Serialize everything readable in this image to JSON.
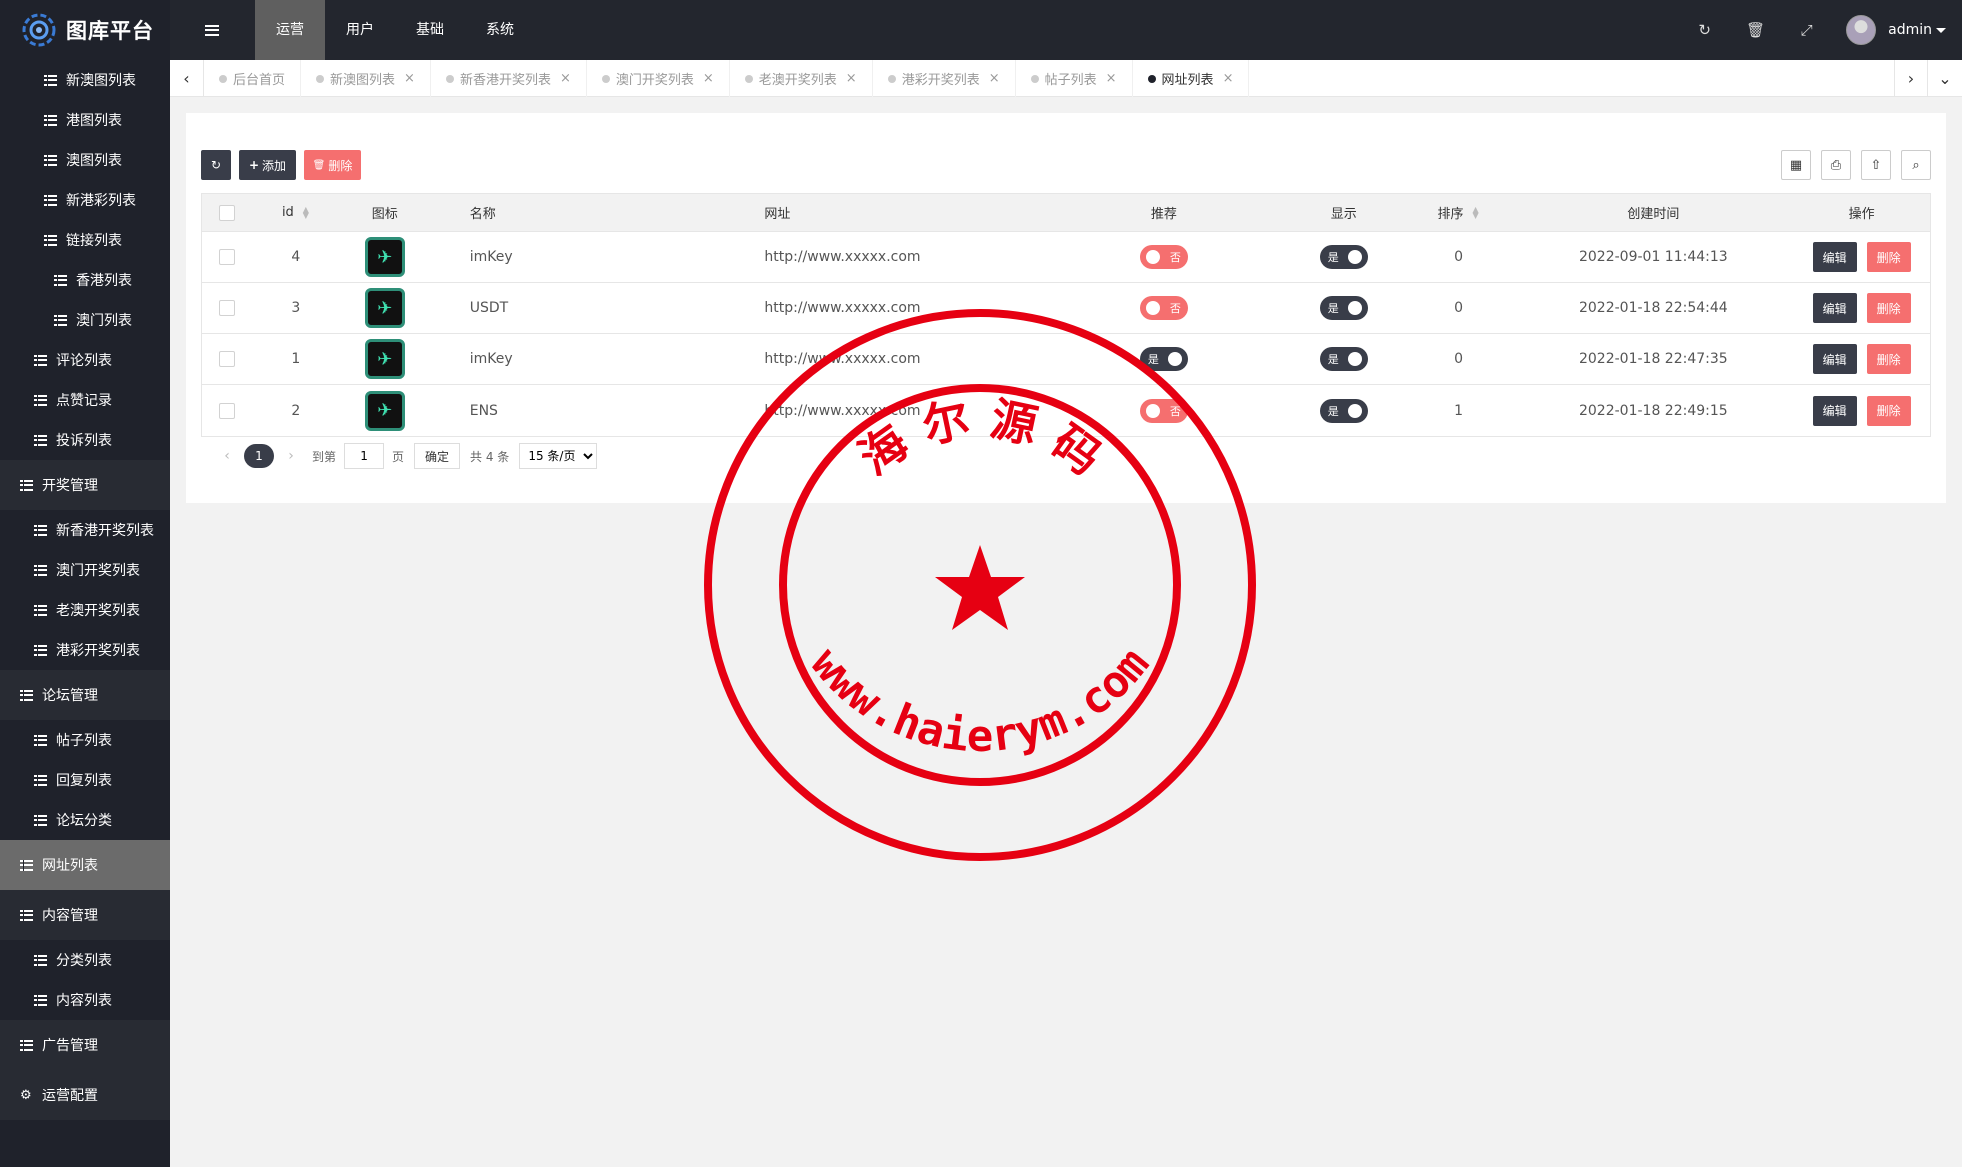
{
  "app": {
    "title": "图库平台"
  },
  "sidebar": {
    "items": [
      {
        "label": "新澳图列表",
        "level": "lvl2"
      },
      {
        "label": "港图列表",
        "level": "lvl2"
      },
      {
        "label": "澳图列表",
        "level": "lvl2"
      },
      {
        "label": "新港彩列表",
        "level": "lvl2"
      },
      {
        "label": "链接列表",
        "level": "lvl2"
      },
      {
        "label": "香港列表",
        "level": "lvl3"
      },
      {
        "label": "澳门列表",
        "level": "lvl3"
      },
      {
        "label": "评论列表",
        "level": "lvl2b"
      },
      {
        "label": "点赞记录",
        "level": "lvl2b"
      },
      {
        "label": "投诉列表",
        "level": "lvl2b"
      },
      {
        "label": "开奖管理",
        "level": "group"
      },
      {
        "label": "新香港开奖列表",
        "level": "lvl2b"
      },
      {
        "label": "澳门开奖列表",
        "level": "lvl2b"
      },
      {
        "label": "老澳开奖列表",
        "level": "lvl2b"
      },
      {
        "label": "港彩开奖列表",
        "level": "lvl2b"
      },
      {
        "label": "论坛管理",
        "level": "group"
      },
      {
        "label": "帖子列表",
        "level": "lvl2b"
      },
      {
        "label": "回复列表",
        "level": "lvl2b"
      },
      {
        "label": "论坛分类",
        "level": "lvl2b"
      },
      {
        "label": "网址列表",
        "level": "group active"
      },
      {
        "label": "内容管理",
        "level": "group"
      },
      {
        "label": "分类列表",
        "level": "lvl2b"
      },
      {
        "label": "内容列表",
        "level": "lvl2b"
      },
      {
        "label": "广告管理",
        "level": "group"
      },
      {
        "label": "运营配置",
        "level": "group",
        "icon": "gear-icon"
      }
    ]
  },
  "topnav": {
    "items": [
      "运营",
      "用户",
      "基础",
      "系统"
    ],
    "active_index": 0,
    "user": "admin"
  },
  "tabs": {
    "items": [
      {
        "label": "后台首页",
        "closable": false
      },
      {
        "label": "新澳图列表",
        "closable": true
      },
      {
        "label": "新香港开奖列表",
        "closable": true
      },
      {
        "label": "澳门开奖列表",
        "closable": true
      },
      {
        "label": "老澳开奖列表",
        "closable": true
      },
      {
        "label": "港彩开奖列表",
        "closable": true
      },
      {
        "label": "帖子列表",
        "closable": true
      },
      {
        "label": "网址列表",
        "closable": true,
        "active": true
      }
    ],
    "close_glyph": "×"
  },
  "toolbar": {
    "refresh_label": "",
    "add_label": "添加",
    "delete_label": "删除"
  },
  "table": {
    "headers": {
      "id": "id",
      "icon": "图标",
      "name": "名称",
      "url": "网址",
      "recommend": "推荐",
      "display": "显示",
      "sort": "排序",
      "created": "创建时间",
      "ops": "操作"
    },
    "rows": [
      {
        "id": "4",
        "name": "imKey",
        "url": "http://www.xxxxx.com",
        "recommend": "否",
        "recommend_on": false,
        "display": "是",
        "display_on": true,
        "sort": "0",
        "created": "2022-09-01 11:44:13"
      },
      {
        "id": "3",
        "name": "USDT",
        "url": "http://www.xxxxx.com",
        "recommend": "否",
        "recommend_on": false,
        "display": "是",
        "display_on": true,
        "sort": "0",
        "created": "2022-01-18 22:54:44"
      },
      {
        "id": "1",
        "name": "imKey",
        "url": "http://www.xxxxx.com",
        "recommend": "是",
        "recommend_on": true,
        "display": "是",
        "display_on": true,
        "sort": "0",
        "created": "2022-01-18 22:47:35"
      },
      {
        "id": "2",
        "name": "ENS",
        "url": "http://www.xxxxx.com",
        "recommend": "否",
        "recommend_on": false,
        "display": "是",
        "display_on": true,
        "sort": "1",
        "created": "2022-01-18 22:49:15"
      }
    ],
    "edit_label": "编辑",
    "delete_label": "删除"
  },
  "pager": {
    "current": "1",
    "goto_prefix": "到第",
    "goto_value": "1",
    "goto_suffix": "页",
    "confirm": "确定",
    "total": "共 4 条",
    "page_size": "15 条/页"
  },
  "watermark": {
    "top_text": "海 尔 源 码",
    "bottom_text": "www.haierym.com"
  },
  "colors": {
    "sidebar_bg": "#1f222b",
    "accent_dark": "#393d49",
    "danger": "#f56f6f",
    "stamp_red": "#e60012"
  }
}
